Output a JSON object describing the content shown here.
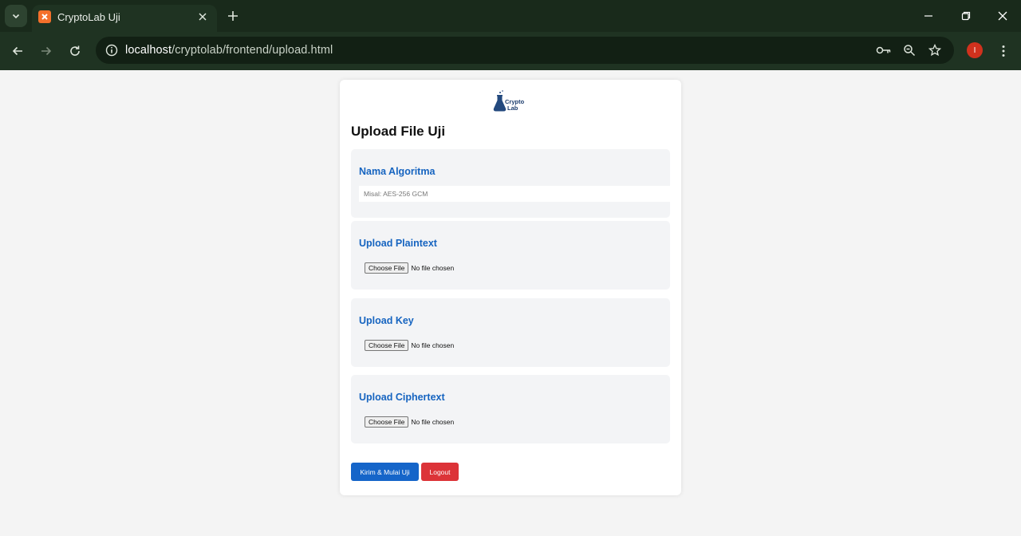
{
  "browser": {
    "tab_title": "CryptoLab Uji",
    "url_host": "localhost",
    "url_path": "/cryptolab/frontend/upload.html",
    "profile_initial": "I",
    "accent": "#1f3322"
  },
  "page": {
    "logo_line1": "Crypto",
    "logo_line2": "Lab",
    "title": "Upload File Uji",
    "algorithm": {
      "label": "Nama Algoritma",
      "placeholder": "Misal: AES-256 GCM"
    },
    "plaintext": {
      "label": "Upload Plaintext",
      "button": "Choose File",
      "status": "No file chosen"
    },
    "key": {
      "label": "Upload Key",
      "button": "Choose File",
      "status": "No file chosen"
    },
    "ciphertext": {
      "label": "Upload Ciphertext",
      "button": "Choose File",
      "status": "No file chosen"
    },
    "submit_label": "Kirim & Mulai Uji",
    "logout_label": "Logout",
    "colors": {
      "primary": "#1565c9",
      "danger": "#dc3338",
      "label": "#1664c0"
    }
  }
}
